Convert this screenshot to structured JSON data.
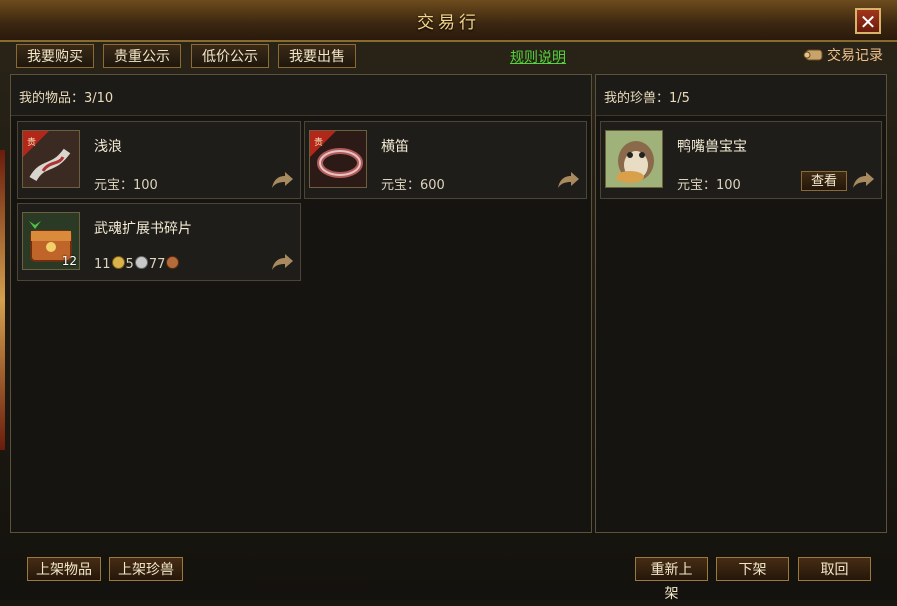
{
  "window": {
    "title": "交易行"
  },
  "tabs": [
    {
      "label": "我要购买"
    },
    {
      "label": "贵重公示"
    },
    {
      "label": "低价公示"
    },
    {
      "label": "我要出售"
    }
  ],
  "header_links": {
    "rules": "规则说明",
    "trade_record": "交易记录"
  },
  "items_panel": {
    "label": "我的物品：3/10",
    "items": [
      {
        "name": "浅浪",
        "price_label": "元宝：",
        "price": "100",
        "icon": "jade-pendant-icon",
        "badge": "贵重"
      },
      {
        "name": "横笛",
        "price_label": "元宝：",
        "price": "600",
        "icon": "bracelet-icon",
        "badge": "贵重"
      },
      {
        "name": "武魂扩展书碎片",
        "icon": "treasure-chest-icon",
        "stack": "12",
        "price_gold": "11",
        "price_silver": "5",
        "price_copper": "77"
      }
    ]
  },
  "pets_panel": {
    "label": "我的珍兽：1/5",
    "items": [
      {
        "name": "鸭嘴兽宝宝",
        "price_label": "元宝：",
        "price": "100",
        "icon": "platypus-pet-icon",
        "view_label": "查看"
      }
    ]
  },
  "bottom_buttons": {
    "list_item": "上架物品",
    "list_pet": "上架珍兽",
    "relist": "重新上架",
    "delist": "下架",
    "cancel": "取回"
  },
  "colors": {
    "accent_gold": "#f2d48a",
    "link_green": "#55d13c",
    "badge_red": "#b3261a"
  }
}
